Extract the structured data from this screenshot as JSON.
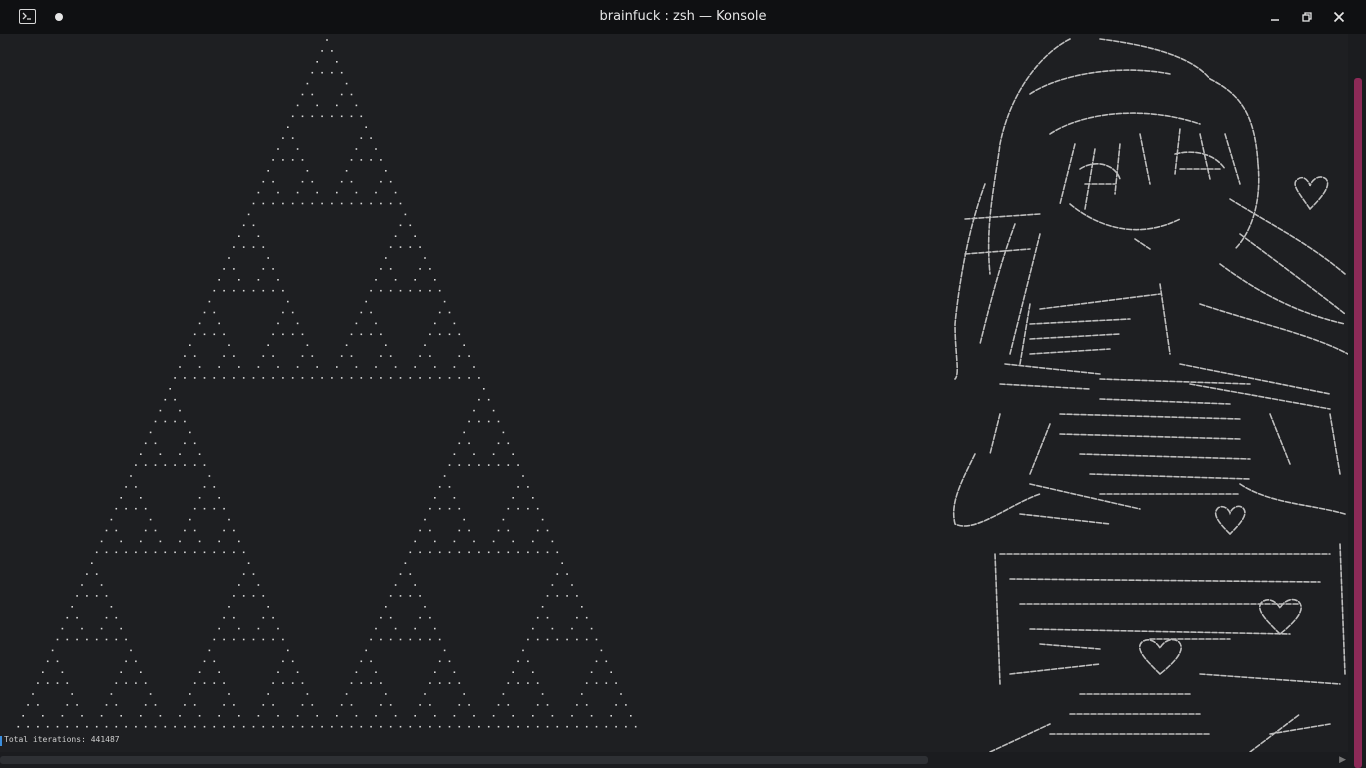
{
  "window": {
    "title": "brainfuck : zsh — Konsole",
    "icon": "terminal-icon",
    "new_tab_indicator": "dot-icon",
    "controls": [
      "minimize-icon",
      "restore-icon",
      "close-icon"
    ]
  },
  "terminal": {
    "status_text": "Total iterations: 441487",
    "fg_color": "#d8d8d8",
    "bg_color": "#1e1f22",
    "fractal": "sierpinski-triangle",
    "ascii_art": "ascii-art-girl",
    "ascii_heart_glyph": "♡"
  },
  "scrollbar": {
    "accent": "#8c2a57"
  }
}
